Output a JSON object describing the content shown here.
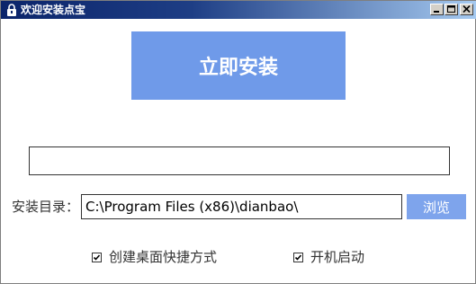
{
  "window": {
    "title": "欢迎安装点宝",
    "icon": "lock-app-icon",
    "controls": [
      "minimize-icon",
      "maximize-icon",
      "close-icon"
    ]
  },
  "install_button": {
    "label": "立即安装"
  },
  "progress": {
    "value": 0
  },
  "install_dir": {
    "label": "安装目录：",
    "value": "C:\\Program Files (x86)\\dianbao\\"
  },
  "browse_button": {
    "label": "浏览"
  },
  "options": {
    "desktop_shortcut": {
      "label": "创建桌面快捷方式",
      "checked": true
    },
    "autostart": {
      "label": "开机启动",
      "checked": true
    }
  },
  "colors": {
    "accent": "#6f9ae9",
    "browse": "#7ea4ec",
    "title_start": "#0b246a",
    "title_end": "#a6caf0"
  }
}
